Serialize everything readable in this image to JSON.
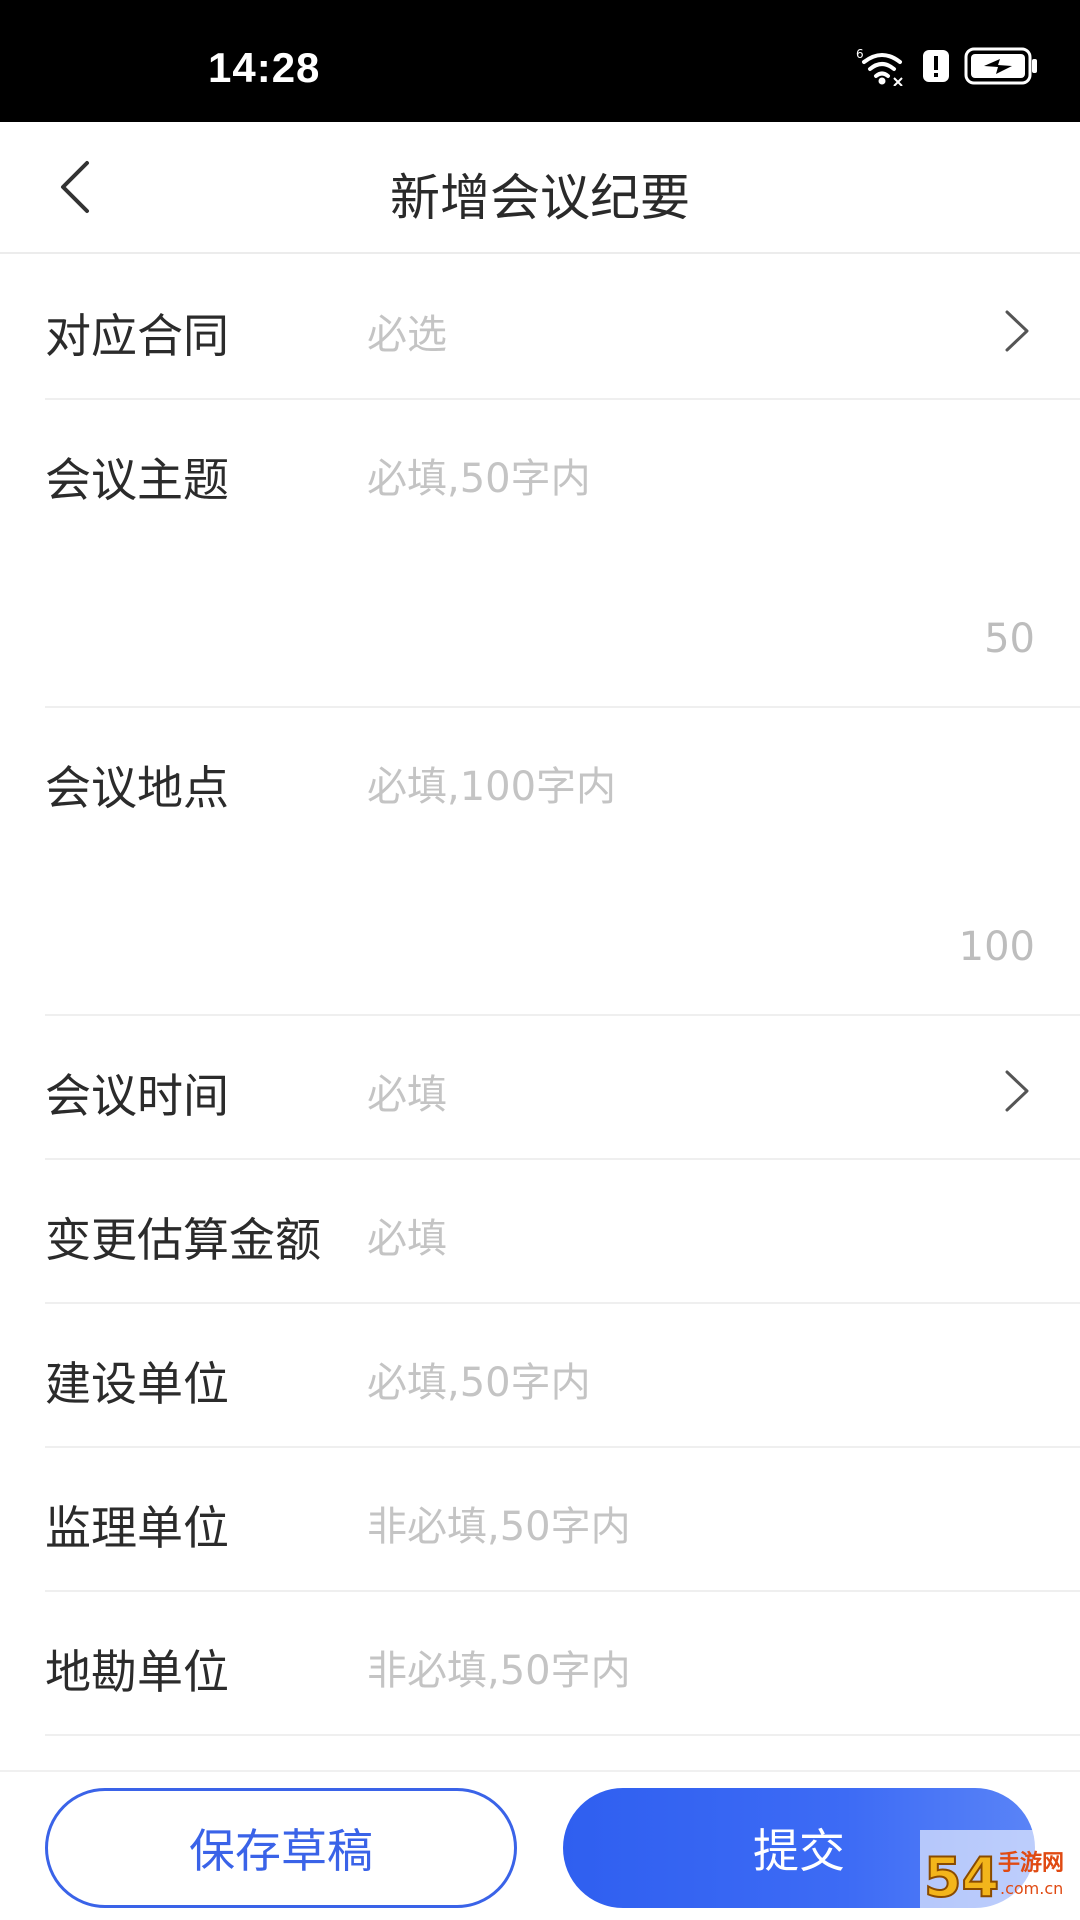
{
  "status_bar": {
    "time": "14:28"
  },
  "nav": {
    "title": "新增会议纪要"
  },
  "form": {
    "contract": {
      "label": "对应合同",
      "placeholder": "必选"
    },
    "subject": {
      "label": "会议主题",
      "placeholder": "必填,50字内",
      "counter": "50"
    },
    "location": {
      "label": "会议地点",
      "placeholder": "必填,100字内",
      "counter": "100"
    },
    "time": {
      "label": "会议时间",
      "placeholder": "必填"
    },
    "amount": {
      "label": "变更估算金额",
      "placeholder": "必填"
    },
    "construction_unit": {
      "label": "建设单位",
      "placeholder": "必填,50字内"
    },
    "supervision_unit": {
      "label": "监理单位",
      "placeholder": "非必填,50字内"
    },
    "survey_unit": {
      "label": "地勘单位",
      "placeholder": "非必填,50字内"
    }
  },
  "actions": {
    "save_draft": "保存草稿",
    "submit": "提交"
  },
  "watermark": {
    "text": "54 手游网"
  },
  "colors": {
    "accent": "#3a63e8",
    "placeholder": "#c4c4c4",
    "status_bar": "#000000"
  },
  "icons": [
    "wifi-icon",
    "alert-icon",
    "battery-charging-icon",
    "back-arrow-icon",
    "chevron-right-icon"
  ]
}
